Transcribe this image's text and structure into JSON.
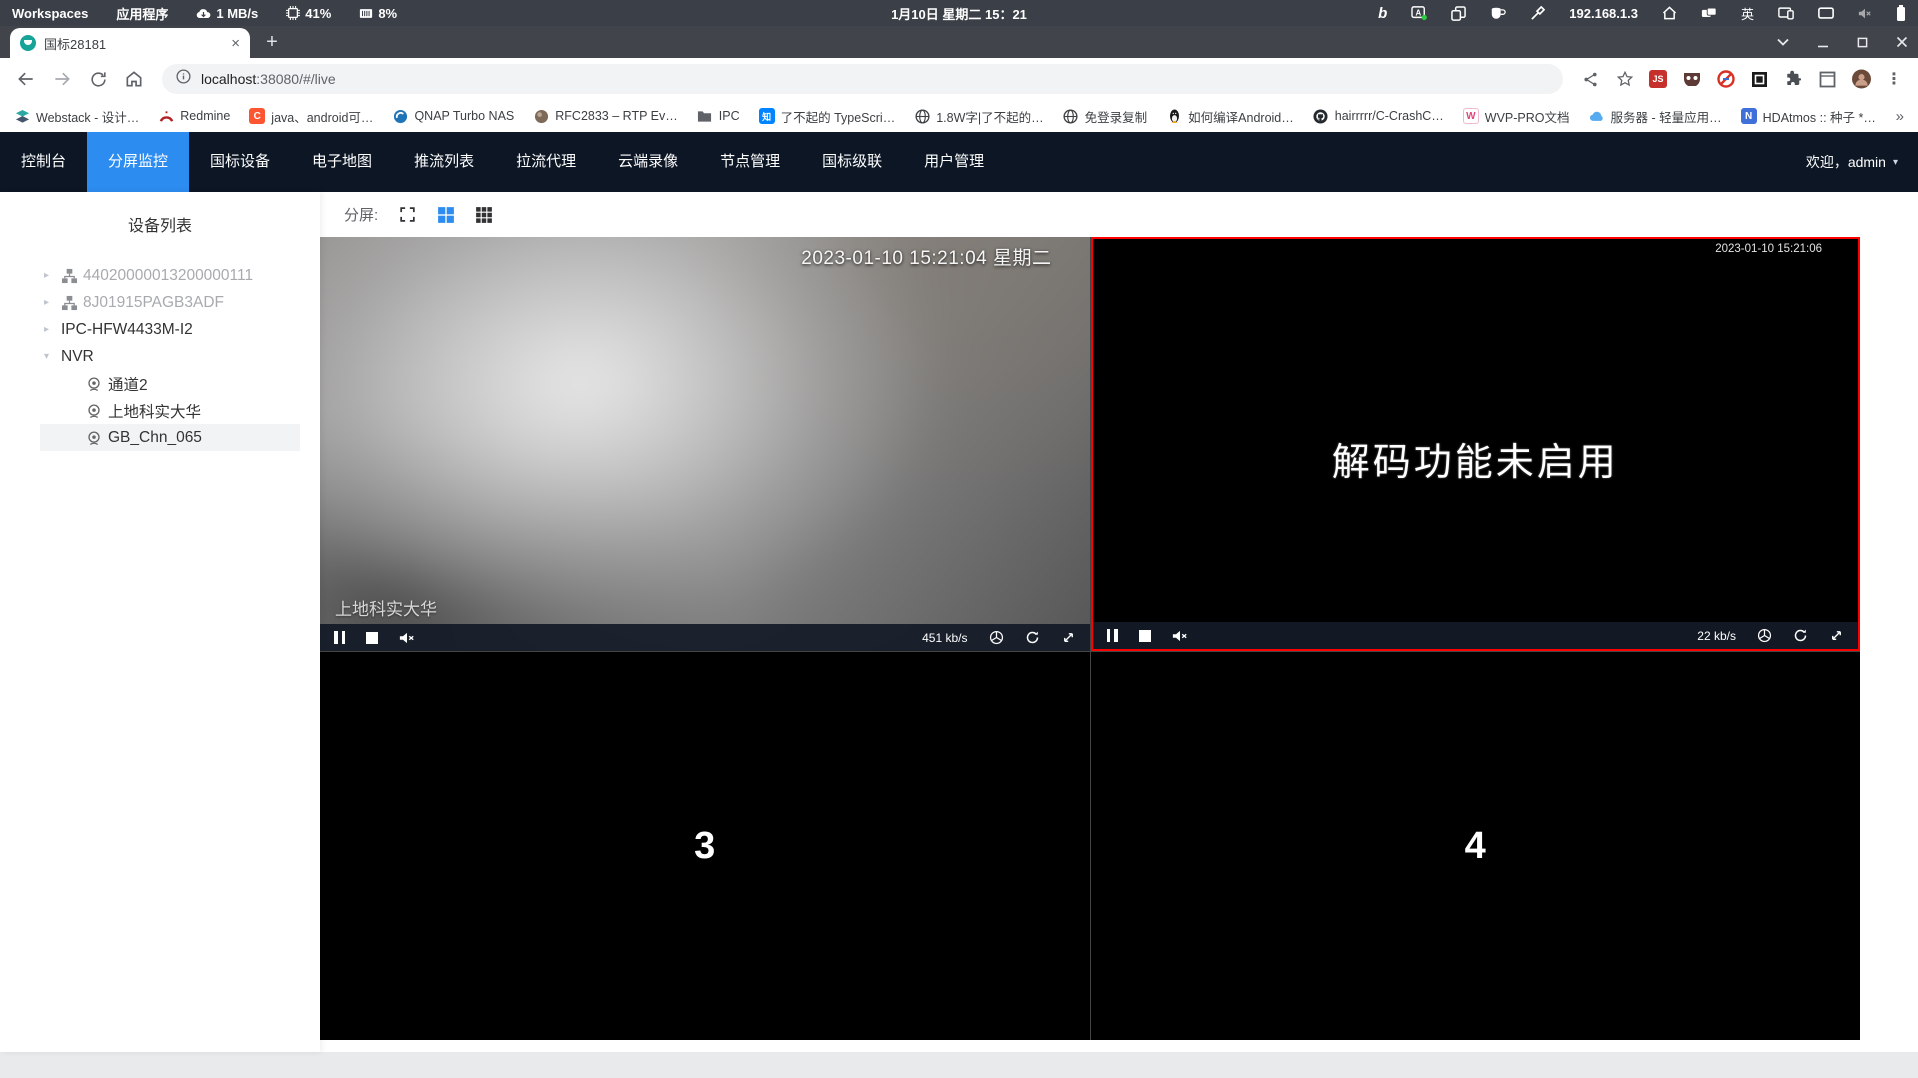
{
  "colors": {
    "nav_accent": "#2d8cf0",
    "selected_video_border": "#ff0000",
    "appnav_background": "#0c1624",
    "tab_favicon": "#17a398"
  },
  "system_bar": {
    "workspaces_label": "Workspaces",
    "applications_label": "应用程序",
    "network_speed": "1 MB/s",
    "cpu_usage": "41%",
    "memory_usage": "8%",
    "clock": "1月10日 星期二 15：21",
    "ip_address": "192.168.1.3",
    "input_method": "英",
    "bing_glyph": "b"
  },
  "browser": {
    "tab_title": "国标28181",
    "close_tab_glyph": "×",
    "new_tab_glyph": "+",
    "url_host": "localhost",
    "url_rest": ":38080/#/live",
    "menu_dots_glyph": "⋮",
    "ext_js_label": "JS"
  },
  "bookmarks": {
    "items": [
      {
        "icon": "webstack-icon",
        "label": "Webstack - 设计…"
      },
      {
        "icon": "redmine-icon",
        "label": "Redmine"
      },
      {
        "icon": "csdn-icon",
        "label": "java、android可…",
        "badge": "C"
      },
      {
        "icon": "qnap-icon",
        "label": "QNAP Turbo NAS"
      },
      {
        "icon": "rfc-icon",
        "label": "RFC2833 – RTP Ev…"
      },
      {
        "icon": "folder-icon",
        "label": "IPC"
      },
      {
        "icon": "zhihu-icon",
        "label": "了不起的 TypeScri…",
        "badge": "知"
      },
      {
        "icon": "globe-icon",
        "label": "1.8W字|了不起的…"
      },
      {
        "icon": "globe-icon",
        "label": "免登录复制"
      },
      {
        "icon": "tux-icon",
        "label": "如何编译Android…"
      },
      {
        "icon": "github-icon",
        "label": "hairrrrr/C-CrashC…"
      },
      {
        "icon": "wvp-icon",
        "label": "WVP-PRO文档",
        "badge": "W"
      },
      {
        "icon": "cloud-icon",
        "label": "服务器 - 轻量应用…"
      },
      {
        "icon": "hdatmos-icon",
        "label": "HDAtmos :: 种子 *…",
        "badge": "N"
      }
    ],
    "overflow_glyph": "»"
  },
  "nav": {
    "items": [
      {
        "label": "控制台",
        "active": false
      },
      {
        "label": "分屏监控",
        "active": true
      },
      {
        "label": "国标设备",
        "active": false
      },
      {
        "label": "电子地图",
        "active": false
      },
      {
        "label": "推流列表",
        "active": false
      },
      {
        "label": "拉流代理",
        "active": false
      },
      {
        "label": "云端录像",
        "active": false
      },
      {
        "label": "节点管理",
        "active": false
      },
      {
        "label": "国标级联",
        "active": false
      },
      {
        "label": "用户管理",
        "active": false
      }
    ],
    "welcome": "欢迎，admin",
    "caret_glyph": "▾"
  },
  "sidebar": {
    "title": "设备列表",
    "collapsed_glyph": "▸",
    "expanded_glyph": "▾",
    "devices": [
      {
        "label": "44020000013200000111",
        "offline": true,
        "expanded": false
      },
      {
        "label": "8J01915PAGB3ADF",
        "offline": true,
        "expanded": false
      },
      {
        "label": "IPC-HFW4433M-I2",
        "offline": false,
        "expanded": false
      },
      {
        "label": "NVR",
        "offline": false,
        "expanded": true
      }
    ],
    "channels": [
      {
        "label": "通道2",
        "selected": false
      },
      {
        "label": "上地科实大华",
        "selected": false
      },
      {
        "label": "GB_Chn_065",
        "selected": true
      }
    ]
  },
  "toolbar": {
    "split_label": "分屏:"
  },
  "players": {
    "video1": {
      "osd_time": "2023-01-10 15:21:04 星期二",
      "name": "上地科实大华",
      "bitrate": "451 kb/s"
    },
    "video2": {
      "osd_time": "2023-01-10 15:21:06",
      "message": "解码功能未启用",
      "bitrate": "22 kb/s"
    },
    "cell3": {
      "number": "3"
    },
    "cell4": {
      "number": "4"
    }
  }
}
